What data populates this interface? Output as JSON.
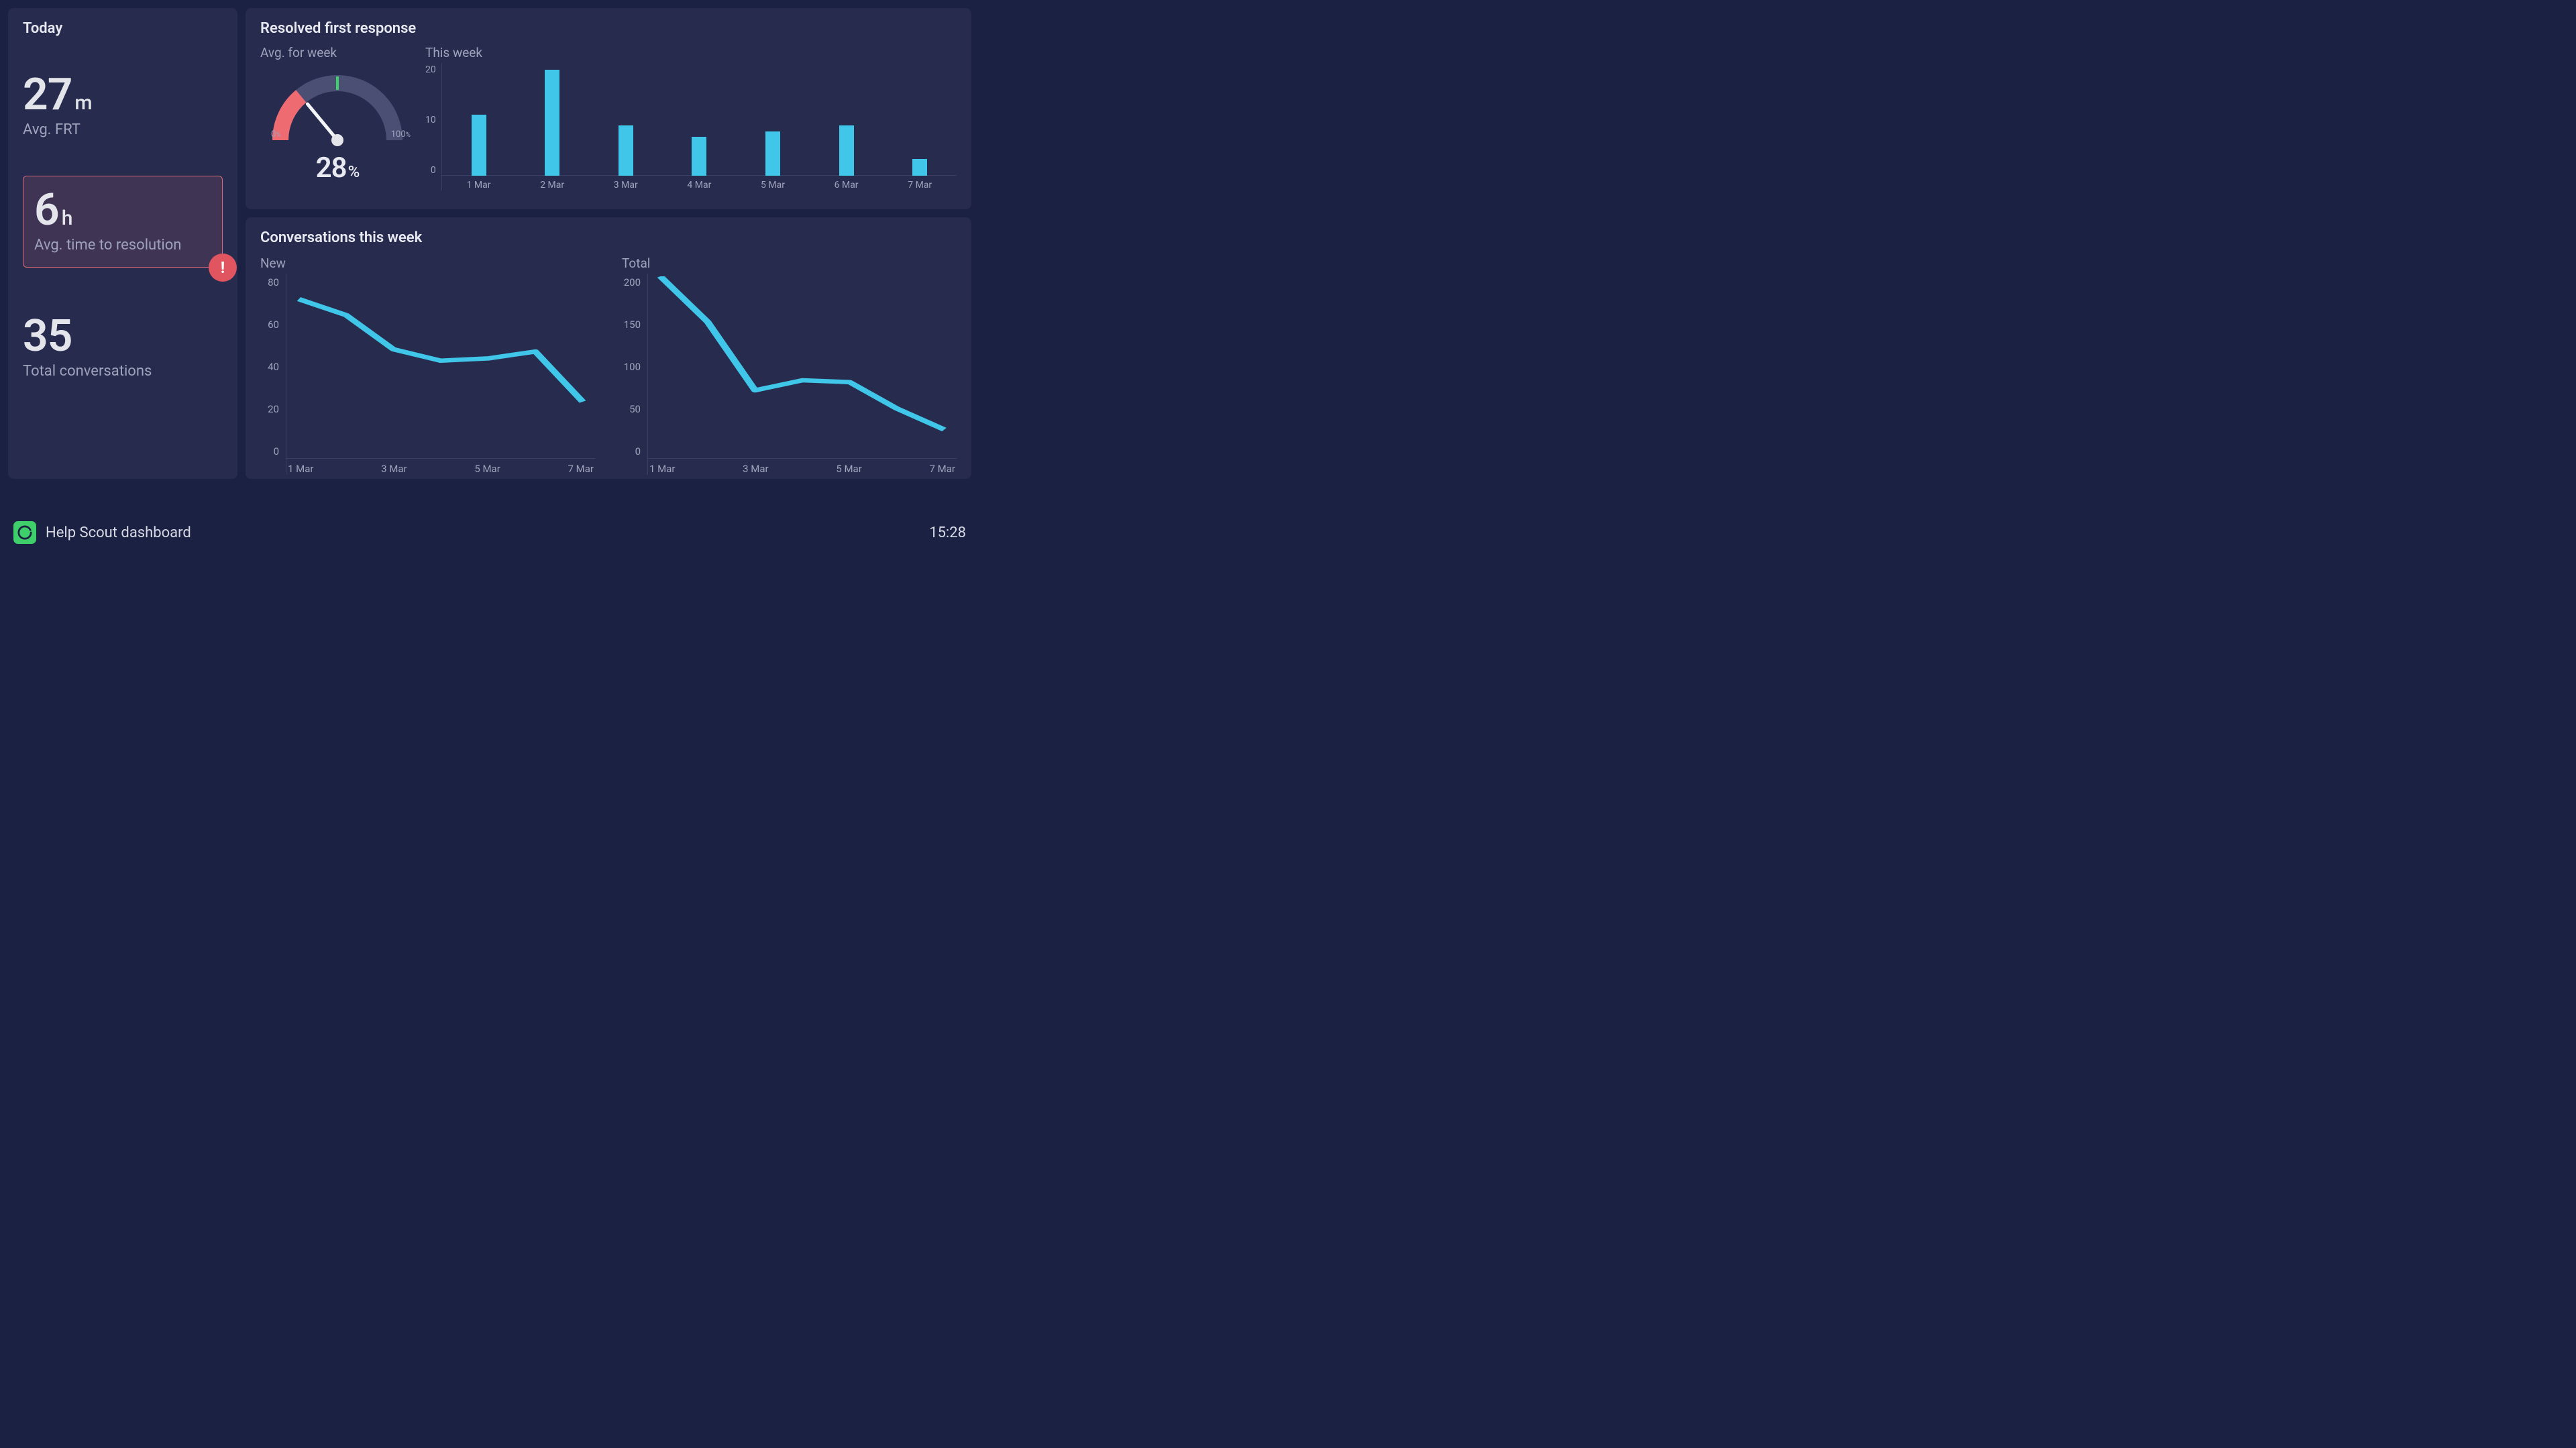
{
  "today": {
    "title": "Today",
    "frt": {
      "value": "27",
      "unit": "m",
      "label": "Avg. FRT"
    },
    "ttr": {
      "value": "6",
      "unit": "h",
      "label": "Avg. time to resolution",
      "alert_glyph": "!"
    },
    "convs": {
      "value": "35",
      "label": "Total conversations"
    }
  },
  "resolved": {
    "title": "Resolved first response",
    "gauge": {
      "subtitle": "Avg. for week",
      "min_label": "0",
      "max_label": "100",
      "pct_sign": "%",
      "value": 28,
      "value_label": "28"
    },
    "bars": {
      "subtitle": "This week",
      "yticks": [
        "20",
        "10",
        "0"
      ]
    }
  },
  "conversations": {
    "title": "Conversations this week",
    "new": {
      "subtitle": "New",
      "yticks": [
        "80",
        "60",
        "40",
        "20",
        "0"
      ],
      "xlabels": [
        "1 Mar",
        "3 Mar",
        "5 Mar",
        "7 Mar"
      ]
    },
    "total": {
      "subtitle": "Total",
      "yticks": [
        "200",
        "150",
        "100",
        "50",
        "0"
      ],
      "xlabels": [
        "1 Mar",
        "3 Mar",
        "5 Mar",
        "7 Mar"
      ]
    }
  },
  "footer": {
    "title": "Help Scout dashboard",
    "time": "15:28"
  },
  "chart_data": [
    {
      "type": "bar",
      "title": "Resolved first response — This week",
      "categories": [
        "1 Mar",
        "2 Mar",
        "3 Mar",
        "4 Mar",
        "5 Mar",
        "6 Mar",
        "7 Mar"
      ],
      "values": [
        11,
        19,
        9,
        7,
        8,
        9,
        3
      ],
      "ylabel": "",
      "xlabel": "",
      "ylim": [
        0,
        20
      ]
    },
    {
      "type": "line",
      "title": "Conversations this week — New",
      "x": [
        "1 Mar",
        "2 Mar",
        "3 Mar",
        "4 Mar",
        "5 Mar",
        "6 Mar",
        "7 Mar"
      ],
      "values": [
        70,
        63,
        48,
        43,
        44,
        47,
        25
      ],
      "ylabel": "",
      "xlabel": "",
      "ylim": [
        0,
        80
      ]
    },
    {
      "type": "line",
      "title": "Conversations this week — Total",
      "x": [
        "1 Mar",
        "2 Mar",
        "3 Mar",
        "4 Mar",
        "5 Mar",
        "6 Mar",
        "7 Mar"
      ],
      "values": [
        200,
        150,
        75,
        86,
        84,
        55,
        32
      ],
      "ylabel": "",
      "xlabel": "",
      "ylim": [
        0,
        200
      ]
    }
  ]
}
